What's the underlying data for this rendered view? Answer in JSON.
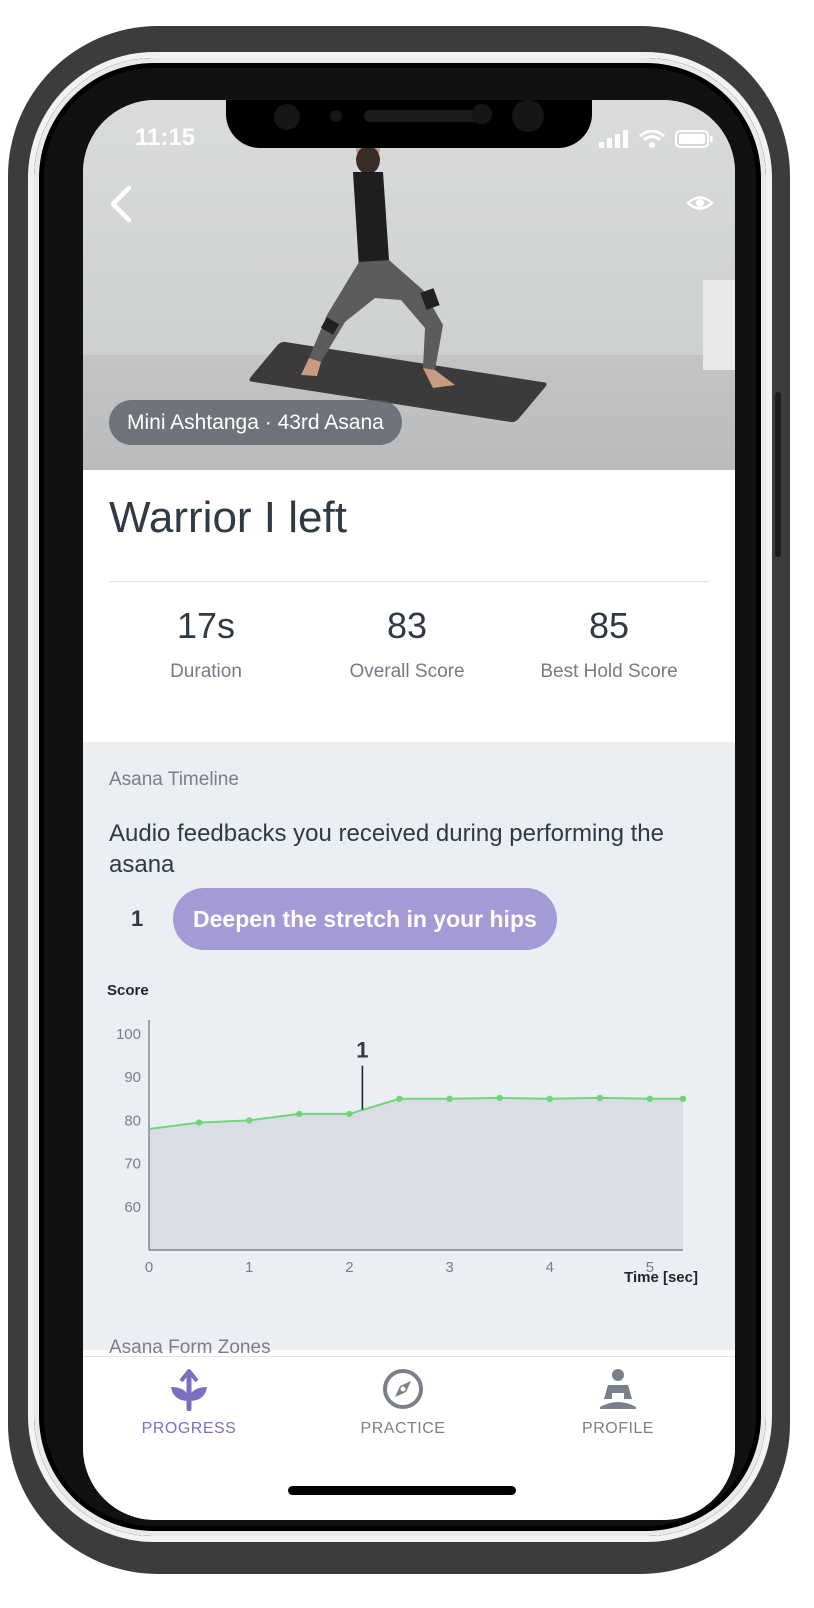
{
  "status_bar": {
    "time": "11:15"
  },
  "hero": {
    "badge": "Mini Ashtanga · 43rd Asana"
  },
  "pose": {
    "title": "Warrior I left"
  },
  "stats": [
    {
      "value": "17s",
      "label": "Duration"
    },
    {
      "value": "83",
      "label": "Overall Score"
    },
    {
      "value": "85",
      "label": "Best Hold Score"
    }
  ],
  "timeline": {
    "section_label": "Asana Timeline",
    "description": "Audio feedbacks you received during performing the asana",
    "feedback": {
      "number": "1",
      "text": "Deepen the stretch in your hips"
    }
  },
  "chart_data": {
    "type": "area",
    "ylabel": "Score",
    "xlabel": "Time [sec]",
    "ylim": [
      50,
      100
    ],
    "xlim": [
      0,
      5.33
    ],
    "y_ticks": [
      "100",
      "90",
      "80",
      "70",
      "60"
    ],
    "x_ticks": [
      "0",
      "1",
      "2",
      "3",
      "4",
      "5"
    ],
    "x": [
      0,
      0.5,
      1,
      1.5,
      2,
      2.5,
      3,
      3.5,
      4,
      4.5,
      5,
      5.33
    ],
    "y": [
      78,
      79.5,
      80,
      81.5,
      81.5,
      85,
      85,
      85.2,
      85,
      85.2,
      85,
      85
    ],
    "color": "#6fd67a",
    "marker": {
      "label": "1",
      "x": 2.13
    }
  },
  "next_section": {
    "label": "Asana Form Zones"
  },
  "tabs": [
    {
      "label": "PROGRESS",
      "icon": "sprout-icon",
      "active": true
    },
    {
      "label": "PRACTICE",
      "icon": "compass-icon",
      "active": false
    },
    {
      "label": "PROFILE",
      "icon": "meditation-person-icon",
      "active": false
    }
  ],
  "colors": {
    "accent": "#7b6fc0",
    "inactive": "#7a8089",
    "pill": "#a39bd5"
  }
}
